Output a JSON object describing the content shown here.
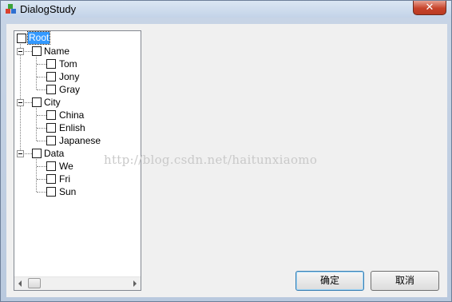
{
  "window": {
    "title": "DialogStudy",
    "close_label": "✕"
  },
  "tree": {
    "root": {
      "label": "Root",
      "checked": false,
      "selected": true
    },
    "groups": [
      {
        "label": "Name",
        "expanded": true,
        "children": [
          "Tom",
          "Jony",
          "Gray"
        ]
      },
      {
        "label": "City",
        "expanded": true,
        "children": [
          "China",
          "Enlish",
          "Japanese"
        ]
      },
      {
        "label": "Data",
        "expanded": true,
        "children": [
          "We",
          "Fri",
          "Sun"
        ]
      }
    ]
  },
  "watermark": "http://blog.csdn.net/haitunxiaomo",
  "buttons": {
    "ok_label": "确定",
    "cancel_label": "取消"
  }
}
